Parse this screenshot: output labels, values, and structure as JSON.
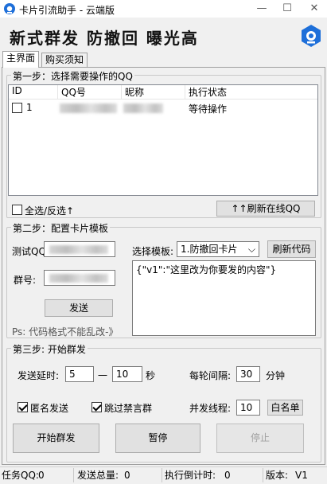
{
  "window": {
    "title": "卡片引流助手 - 云端版",
    "minimize": "—",
    "maximize": "☐",
    "close": "✕"
  },
  "banner": {
    "slogan": "新式群发 防撤回 曝光高"
  },
  "tabs": [
    {
      "label": "主界面",
      "active": true
    },
    {
      "label": "购买须知",
      "active": false
    }
  ],
  "step1": {
    "title": "第一步：选择需要操作的QQ",
    "columns": [
      "ID",
      "QQ号",
      "昵称",
      "执行状态"
    ],
    "rows": [
      {
        "id": "1",
        "status": "等待操作",
        "checked": false
      }
    ],
    "select_all_label": "全选/反选↑",
    "refresh_button": "↑↑刷新在线QQ"
  },
  "step2": {
    "title": "第二步：配置卡片模板",
    "test_qq_label": "测试QQ",
    "group_label": "群号:",
    "send_button": "发送",
    "hint": "Ps: 代码格式不能乱改-》",
    "template_label": "选择模板:",
    "template_selected": "1.防撤回卡片",
    "refresh_code_button": "刷新代码",
    "code_text": "{\"v1\":\"这里改为你要发的内容\"}"
  },
  "step3": {
    "title": "第三步: 开始群发",
    "delay_label": "发送延时:",
    "delay_min": "5",
    "dash": "一",
    "delay_max": "10",
    "delay_unit": "秒",
    "interval_label": "每轮间隔:",
    "interval_value": "30",
    "interval_unit": "分钟",
    "anonymous_label": "匿名发送",
    "anonymous_checked": true,
    "skip_muted_label": "跳过禁言群",
    "skip_muted_checked": true,
    "threads_label": "并发线程:",
    "threads_value": "10",
    "whitelist_button": "白名单",
    "start_button": "开始群发",
    "pause_button": "暂停",
    "stop_button": "停止"
  },
  "status": {
    "task_qq_label": "任务QQ:",
    "task_qq_value": "0",
    "total_label": "发送总量:",
    "total_value": "0",
    "countdown_label": "执行倒计时:",
    "countdown_value": "0",
    "version_label": "版本:",
    "version_value": "V1"
  },
  "colors": {
    "accent": "#1e6fd9"
  }
}
